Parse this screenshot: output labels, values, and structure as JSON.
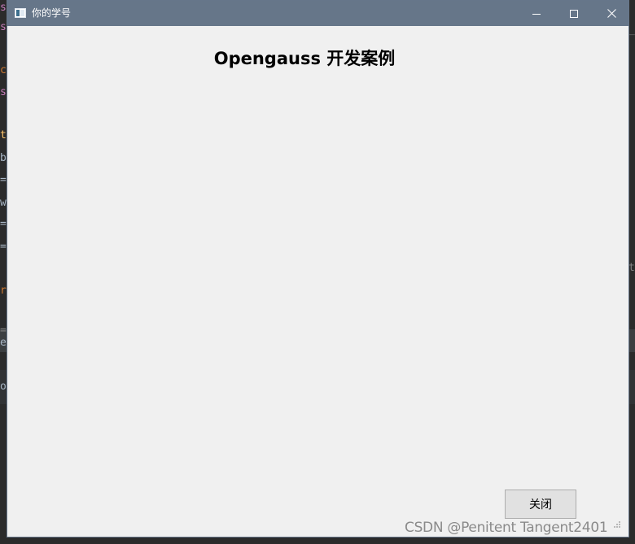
{
  "window": {
    "title": "你的学号",
    "minimize_icon": "minimize-icon",
    "maximize_icon": "maximize-icon",
    "close_icon": "close-icon",
    "titlebar_color": "#667689",
    "background_color": "#f0f0f0"
  },
  "main": {
    "heading": "Opengauss 开发案例"
  },
  "footer": {
    "close_button_label": "关闭"
  },
  "watermark": {
    "text": "CSDN @Penitent Tangent2401"
  },
  "background_editor": {
    "fragments": [
      "s",
      "s",
      "c",
      "s",
      "t",
      "b",
      "=",
      "w",
      "=",
      "=",
      "r",
      "=",
      "e",
      "o",
      "_",
      "t"
    ]
  }
}
